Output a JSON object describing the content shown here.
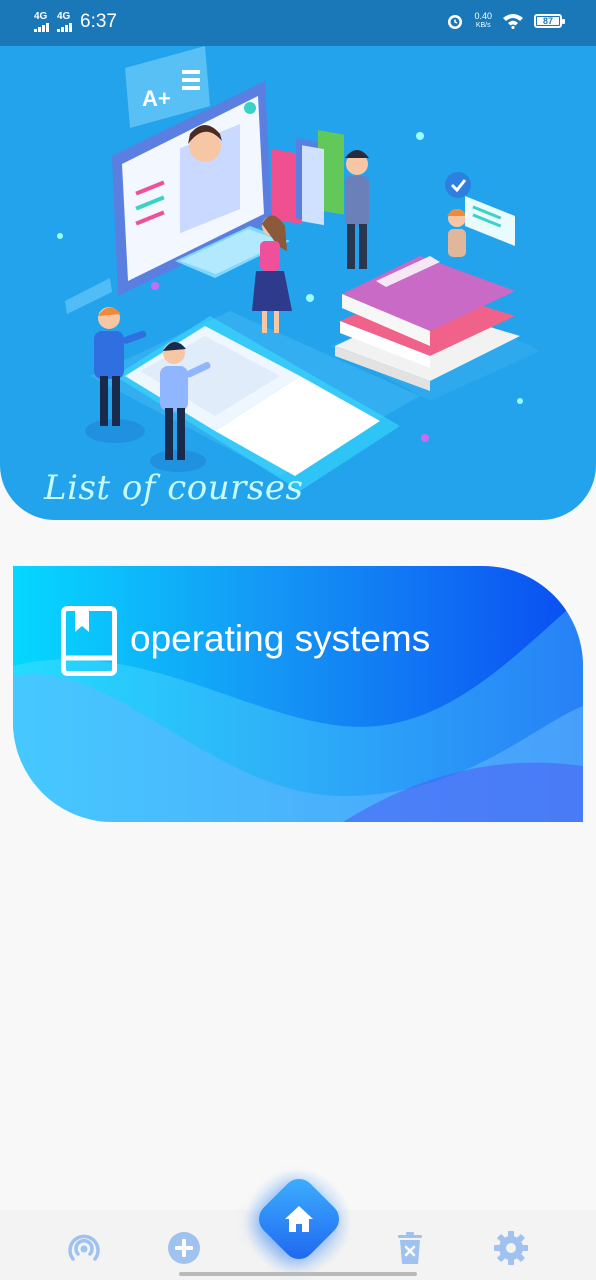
{
  "status_bar": {
    "sim1": "4G",
    "sim2": "4G",
    "time": "6:37",
    "net_speed_value": "0.40",
    "net_speed_unit": "KB/s",
    "battery": "87"
  },
  "hero": {
    "title": "List of courses",
    "grade_badge": "A+"
  },
  "courses": [
    {
      "name": "operating systems",
      "icon": "book-bookmark-icon"
    }
  ],
  "bottom_nav": {
    "items": [
      {
        "icon": "broadcast-icon"
      },
      {
        "icon": "add-circle-icon"
      },
      {
        "icon": "home-icon",
        "active": true
      },
      {
        "icon": "trash-icon"
      },
      {
        "icon": "gear-icon"
      }
    ]
  },
  "colors": {
    "status_bar": "#1b78b8",
    "hero_bg": "#22a3ec",
    "card_gradient_start": "#05d8ff",
    "card_gradient_end": "#0a4cf2",
    "nav_icon": "#9fc2ee",
    "home_button": "#2d8cf5"
  }
}
